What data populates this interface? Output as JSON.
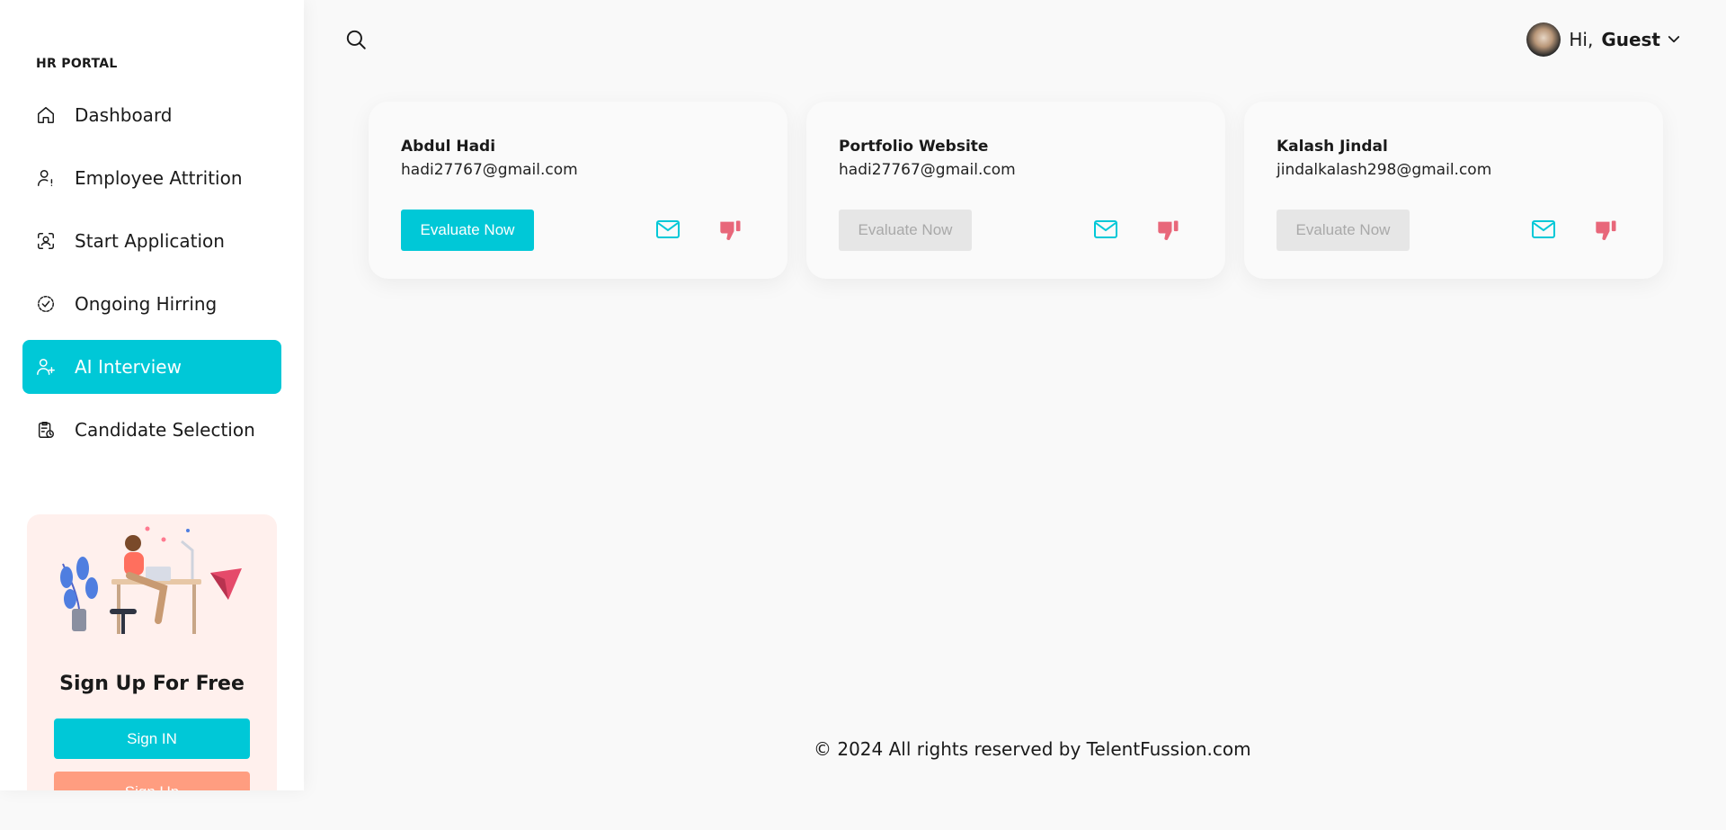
{
  "brand": "HR PORTAL",
  "sidebar": {
    "items": [
      {
        "label": "Dashboard",
        "icon": "home-icon",
        "active": false
      },
      {
        "label": "Employee Attrition",
        "icon": "user-alert-icon",
        "active": false
      },
      {
        "label": "Start Application",
        "icon": "face-scan-icon",
        "active": false
      },
      {
        "label": "Ongoing Hirring",
        "icon": "circle-check-icon",
        "active": false
      },
      {
        "label": "AI Interview",
        "icon": "user-plus-icon",
        "active": true
      },
      {
        "label": "Candidate Selection",
        "icon": "clipboard-clock-icon",
        "active": false
      }
    ]
  },
  "promo": {
    "title": "Sign Up For Free",
    "signin_label": "Sign IN",
    "signup_label": "Sign Up"
  },
  "header": {
    "greeting": "Hi,",
    "username": "Guest"
  },
  "cards": [
    {
      "name": "Abdul Hadi",
      "email": "hadi27767@gmail.com",
      "button_label": "Evaluate Now",
      "enabled": true
    },
    {
      "name": "Portfolio Website",
      "email": "hadi27767@gmail.com",
      "button_label": "Evaluate Now",
      "enabled": false
    },
    {
      "name": "Kalash Jindal",
      "email": "jindalkalash298@gmail.com",
      "button_label": "Evaluate Now",
      "enabled": false
    }
  ],
  "footer": "© 2024 All rights reserved by TelentFussion.com",
  "colors": {
    "accent": "#00c8d7",
    "signup": "#ff9d80",
    "dislike": "#e8677a",
    "promo_bg": "#fff0ed"
  }
}
